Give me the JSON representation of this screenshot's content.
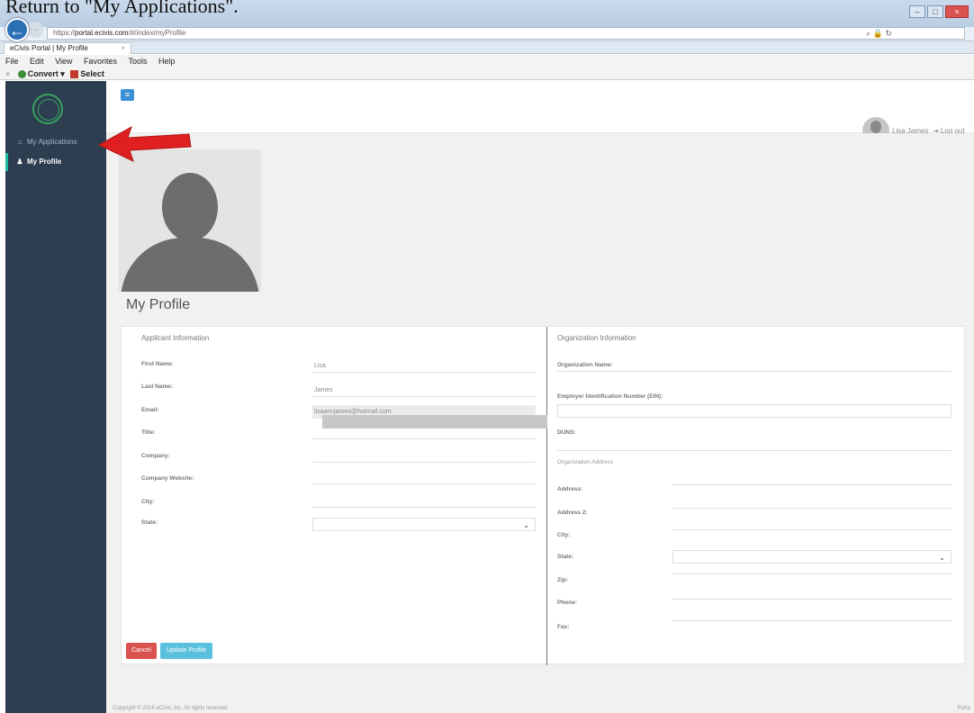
{
  "caption": "Return to \"My Applications\".",
  "browser": {
    "url_prefix": "https://",
    "url_domain": "portal.ecivis.com",
    "url_path": "/#/index/myProfile",
    "tab_title": "eCivis Portal | My Profile",
    "menu": [
      "File",
      "Edit",
      "View",
      "Favorites",
      "Tools",
      "Help"
    ],
    "toolbar": {
      "close": "×",
      "convert": "Convert",
      "select": "Select"
    }
  },
  "sidebar": {
    "items": [
      {
        "label": "My Applications",
        "icon": "home-icon"
      },
      {
        "label": "My Profile",
        "icon": "user-icon"
      }
    ]
  },
  "header": {
    "user_name": "Lisa James",
    "logout": "Log out"
  },
  "page": {
    "title": "My Profile"
  },
  "applicant": {
    "title": "Applicant Information",
    "fields": [
      {
        "label": "First Name:",
        "value": "Lisa"
      },
      {
        "label": "Last Name:",
        "value": "James"
      },
      {
        "label": "Email:",
        "value": "lisaannjames@hotmail.com"
      },
      {
        "label": "Title:",
        "value": ""
      },
      {
        "label": "Company:",
        "value": ""
      },
      {
        "label": "Company Website:",
        "value": ""
      },
      {
        "label": "City:",
        "value": ""
      },
      {
        "label": "State:",
        "value": ""
      }
    ]
  },
  "organization": {
    "title": "Organization Information",
    "fields_top": [
      {
        "label": "Organization Name:"
      },
      {
        "label": "Employer Identification Number (EIN):"
      },
      {
        "label": "DUNS:"
      }
    ],
    "address_heading": "Organization Address",
    "address_fields": [
      {
        "label": "Address:"
      },
      {
        "label": "Address 2:"
      },
      {
        "label": "City:"
      },
      {
        "label": "State:"
      },
      {
        "label": "Zip:"
      },
      {
        "label": "Phone:"
      },
      {
        "label": "Fax:"
      }
    ]
  },
  "buttons": {
    "cancel": "Cancel",
    "update": "Update Profile"
  },
  "footer": {
    "copyright": "Copyright © 2016 eCivis, Inc. All rights reserved.",
    "right": "Porta"
  },
  "colors": {
    "sidebar_bg": "#2c3e50",
    "accent_teal": "#1abc9c",
    "cancel": "#d9534f",
    "update": "#5bc0de",
    "annotation_arrow": "#e02020"
  }
}
